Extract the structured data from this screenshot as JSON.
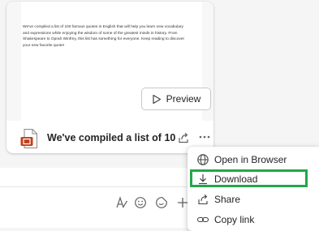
{
  "file_card": {
    "doc_snippet": "We've compiled a list of 100 famous quotes in English that will help you learn new vocabulary and expressions while enjoying the wisdom of some of the greatest minds in history. From Shakespeare to Oprah Winfrey, this list has something for everyone. Keep reading to discover your new favorite quote!",
    "preview_label": "Preview",
    "file_name": "We've compiled a list of 100 ...",
    "icons": {
      "file": "powerpoint-file-icon",
      "share": "share-icon",
      "more": "more-options-icon",
      "preview": "play-icon"
    }
  },
  "context_menu": {
    "items": [
      {
        "label": "Open in Browser",
        "icon": "globe-icon"
      },
      {
        "label": "Download",
        "icon": "download-icon"
      },
      {
        "label": "Share",
        "icon": "share-icon"
      },
      {
        "label": "Copy link",
        "icon": "link-icon"
      }
    ],
    "highlighted": "Download",
    "highlight_color": "#22a849"
  },
  "compose_toolbar": {
    "icons": [
      "format-icon",
      "emoji-icon",
      "sticker-icon",
      "add-icon"
    ]
  },
  "colors": {
    "accent_red": "#c43e1c",
    "highlight_green": "#22a849"
  }
}
